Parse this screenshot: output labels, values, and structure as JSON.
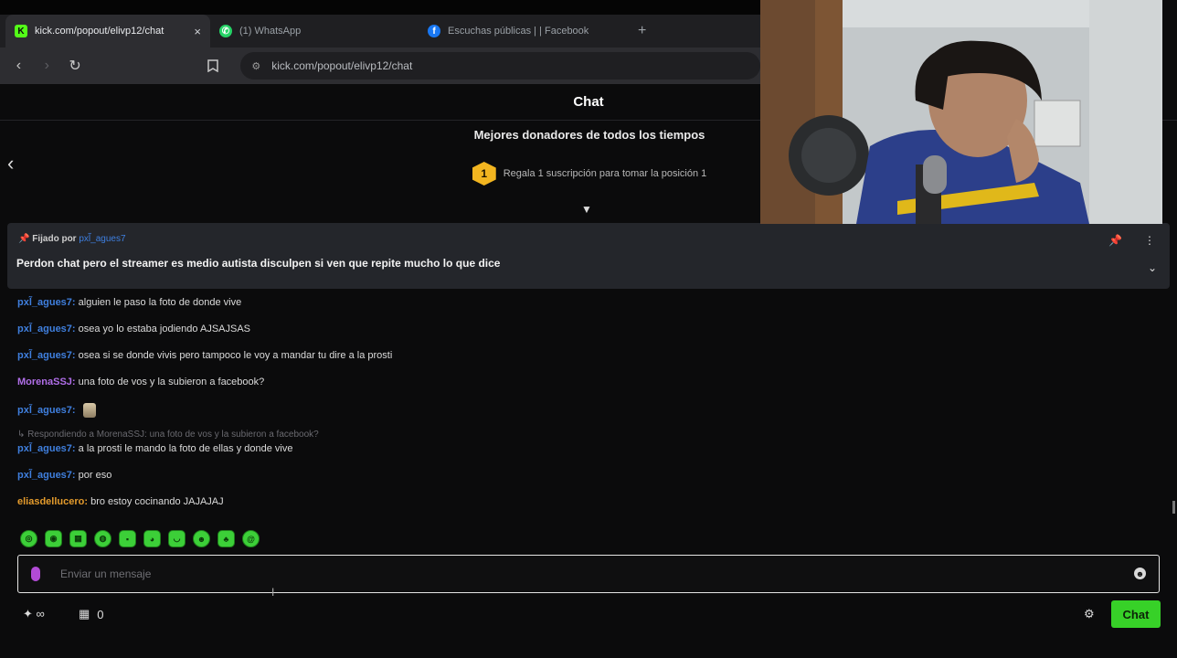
{
  "browser": {
    "tabs": [
      {
        "label": "kick.com/popout/elivp12/chat",
        "icon": "kick-icon",
        "icon_color": "#53fc18",
        "active": true
      },
      {
        "label": "(1) WhatsApp",
        "icon": "whatsapp-icon",
        "icon_color": "#25d366",
        "active": false
      },
      {
        "label": "Escuchas públicas | | Facebook",
        "icon": "facebook-icon",
        "icon_color": "#1877f2",
        "active": false
      }
    ],
    "new_tab": "+",
    "close_tab": "×",
    "url": "kick.com/popout/elivp12/chat"
  },
  "chat": {
    "title": "Chat",
    "top_donors_title": "Mejores donadores de todos los tiempos",
    "top_donor_rank": "1",
    "top_donor_text": "Regala 1 suscripción para tomar la posición 1",
    "pinned": {
      "prefix": "Fijado por",
      "user": "pxl̃_agues7",
      "message": "Perdon chat pero el streamer es medio autista disculpen si ven que repite mucho lo que dice"
    },
    "messages": [
      {
        "user": "pxl̃_agues7:",
        "color": "#3f7fde",
        "text": " alguien le paso la foto de donde vive"
      },
      {
        "user": "pxl̃_agues7:",
        "color": "#3f7fde",
        "text": " osea yo lo estaba jodiendo AJSAJSAS"
      },
      {
        "user": "pxl̃_agues7:",
        "color": "#3f7fde",
        "text": " osea si se donde vivis pero tampoco le voy a mandar tu dire a la prosti"
      },
      {
        "user": "MorenaSSJ:",
        "color": "#b06ee8",
        "text": " una foto de vos y la subieron a facebook?"
      },
      {
        "user": "pxl̃_agues7:",
        "color": "#3f7fde",
        "text": ""
      },
      {
        "user": "pxl̃_agues7:",
        "color": "#3f7fde",
        "text": " a la prosti le mando la foto de ellas y donde vive"
      },
      {
        "user": "pxl̃_agues7:",
        "color": "#3f7fde",
        "text": " por eso"
      },
      {
        "user": "eliasdellucero:",
        "color": "#e49b2c",
        "text": " bro estoy cocinando JAJAJAJ"
      }
    ],
    "reply_note": "↳ Respondiendo a MorenaSSJ: una foto de vos y la subieron a facebook?",
    "input_placeholder": "Enviar un mensaje",
    "infinity_label": "∞",
    "gift_count": "0",
    "send_label": "Chat"
  },
  "colors": {
    "accent_green": "#37d128",
    "kick_green": "#53fc18"
  }
}
